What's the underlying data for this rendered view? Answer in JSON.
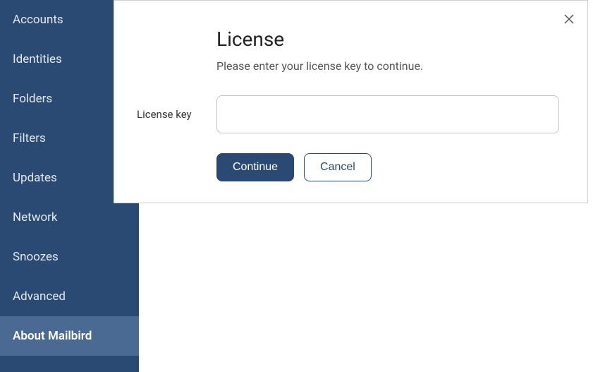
{
  "sidebar": {
    "items": [
      {
        "label": "Accounts",
        "active": false
      },
      {
        "label": "Identities",
        "active": false
      },
      {
        "label": "Folders",
        "active": false
      },
      {
        "label": "Filters",
        "active": false
      },
      {
        "label": "Updates",
        "active": false
      },
      {
        "label": "Network",
        "active": false
      },
      {
        "label": "Snoozes",
        "active": false
      },
      {
        "label": "Advanced",
        "active": false
      },
      {
        "label": "About Mailbird",
        "active": true
      }
    ]
  },
  "dialog": {
    "title": "License",
    "subtitle": "Please enter your license key to continue.",
    "field_label": "License key",
    "input_value": "",
    "continue_label": "Continue",
    "cancel_label": "Cancel"
  }
}
